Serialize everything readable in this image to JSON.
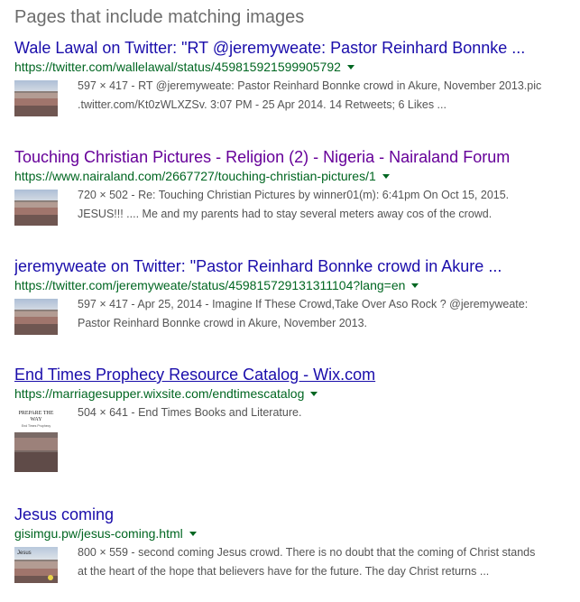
{
  "section_title": "Pages that include matching images",
  "results": [
    {
      "title": "Wale Lawal on Twitter: \"RT @jeremyweate: Pastor Reinhard Bonnke ...",
      "url": "https://twitter.com/wallelawal/status/459815921599905792",
      "snippet_line1": "597 × 417 - RT @jeremyweate: Pastor Reinhard Bonnke crowd in Akure, November 2013.pic",
      "snippet_line2": ".twitter.com/Kt0zWLXZSv. 3:07 PM - 25 Apr 2014. 14 Retweets; 6 Likes ...",
      "thumbnail_icon": "crowd-thumbnail"
    },
    {
      "title": "Touching Christian Pictures - Religion (2) - Nigeria - Nairaland Forum",
      "url": "https://www.nairaland.com/2667727/touching-christian-pictures/1",
      "snippet_line1": "720 × 502 - Re: Touching Christian Pictures by winner01(m): 6:41pm On Oct 15, 2015.",
      "snippet_line2": "JESUS!!! .... Me and my parents had to stay several meters away cos of the crowd.",
      "thumbnail_icon": "crowd-thumbnail"
    },
    {
      "title": "jeremyweate on Twitter: \"Pastor Reinhard Bonnke crowd in Akure ...",
      "url": "https://twitter.com/jeremyweate/status/459815729131311104?lang=en",
      "snippet_line1": "597 × 417 - Apr 25, 2014 - Imagine If These Crowd,Take Over Aso Rock ? @jeremyweate:",
      "snippet_line2": "Pastor Reinhard Bonnke crowd in Akure, November 2013.",
      "thumbnail_icon": "crowd-thumbnail"
    },
    {
      "title": "End Times Prophecy Resource Catalog - Wix.com",
      "url": "https://marriagesupper.wixsite.com/endtimescatalog",
      "snippet_line1": "504 × 641 - End Times Books and Literature.",
      "snippet_line2": "",
      "thumbnail_icon": "book-cover-thumbnail",
      "thumb_text_1": "PREPARE THE",
      "thumb_text_2": "WAY",
      "thumb_text_3": "End Times Prophecy"
    },
    {
      "title": "Jesus coming",
      "url": "gisimgu.pw/jesus-coming.html",
      "snippet_line1": "800 × 559 - second coming Jesus crowd. There is no doubt that the coming of Christ stands",
      "snippet_line2": "at the heart of the hope that believers have for the future. The day Christ returns ...",
      "thumbnail_icon": "crowd-thumbnail",
      "thumb_text_1": "Jesus"
    }
  ],
  "colors": {
    "link": "#1a0dab",
    "visited_link": "#660099",
    "url_green": "#006621",
    "snippet": "#545454",
    "section_title": "#6c6c6c"
  }
}
